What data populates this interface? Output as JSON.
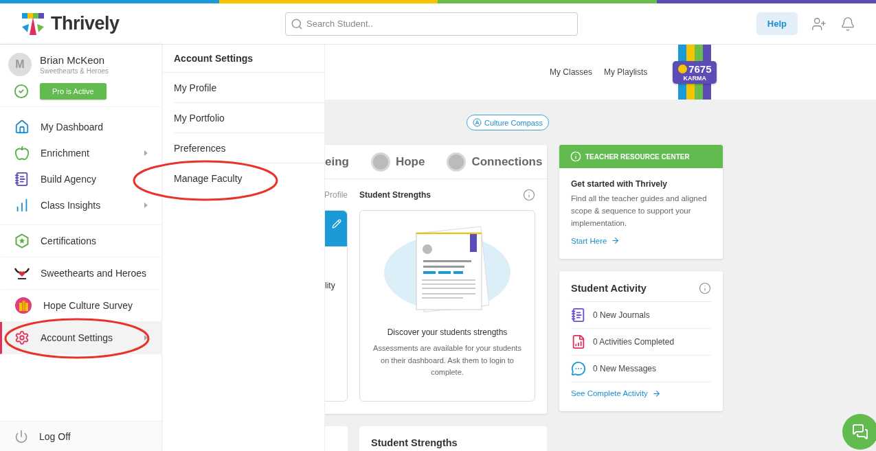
{
  "header": {
    "logo": "Thrively",
    "search": {
      "placeholder": "Search Student.."
    },
    "help": "Help"
  },
  "user": {
    "initial": "M",
    "name": "Brian McKeon",
    "org": "Sweethearts & Heroes",
    "pro_badge": "Pro is Active"
  },
  "sidebar": {
    "main_items": [
      {
        "label": "My Dashboard",
        "kind": "home",
        "has_submenu": false,
        "selected": false
      },
      {
        "label": "Enrichment",
        "kind": "apple",
        "has_submenu": true,
        "selected": false
      },
      {
        "label": "Build Agency",
        "kind": "notebook",
        "has_submenu": false,
        "selected": false
      },
      {
        "label": "Class Insights",
        "kind": "chart",
        "has_submenu": true,
        "selected": false
      }
    ],
    "program_items": [
      {
        "label": "Certifications",
        "kind": "certificate",
        "has_submenu": false,
        "selected": false
      },
      {
        "label": "Sweethearts and Heroes",
        "kind": "heroes",
        "has_submenu": false,
        "selected": false
      },
      {
        "label": "Hope Culture Survey",
        "kind": "survey",
        "has_submenu": false,
        "selected": false
      },
      {
        "label": "Account Settings",
        "kind": "settings",
        "has_submenu": true,
        "selected": true
      }
    ],
    "log_off": "Log Off"
  },
  "submenu": {
    "title": "Account Settings",
    "items": [
      "My Profile",
      "My Portfolio",
      "Preferences",
      "Manage Faculty"
    ]
  },
  "nav_links": [
    "My Classes",
    "My Playlists"
  ],
  "karma": {
    "points": "7675",
    "label": "KARMA"
  },
  "culture_compass": "Culture Compass",
  "pillar_card": {
    "tabs": [
      {
        "label": "eing",
        "icon": false
      },
      {
        "label": "Hope",
        "icon": true
      },
      {
        "label": "Connections",
        "icon": true
      }
    ],
    "subtabs": [
      "Profile",
      "Student Strengths"
    ],
    "side_card_text": "lity",
    "strengths": {
      "title": "Discover your students strengths",
      "body": "Assessments are available for your students on their dashboard. Ask them to login to complete."
    }
  },
  "bottom_card": {
    "title": "Student Strengths"
  },
  "resource_center": {
    "header": "TEACHER RESOURCE CENTER",
    "title": "Get started with Thrively",
    "body": "Find all the teacher guides and aligned scope & sequence to support your implementation.",
    "link": "Start Here"
  },
  "student_activity": {
    "title": "Student Activity",
    "rows": [
      {
        "kind": "journal",
        "text": "0 New Journals"
      },
      {
        "kind": "activity",
        "text": "0 Activities Completed"
      },
      {
        "kind": "message",
        "text": "0 New Messages"
      }
    ],
    "link": "See Complete Activity"
  }
}
